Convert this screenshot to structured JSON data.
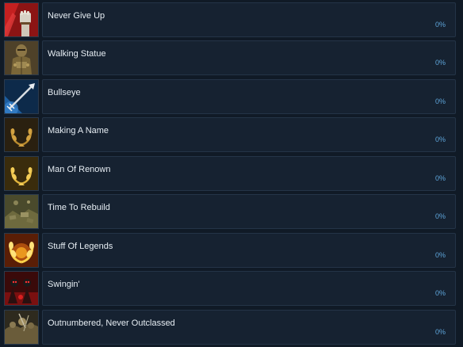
{
  "achievements": [
    {
      "title": "Never Give Up",
      "percent": "0%",
      "icon": "raised-fist-icon"
    },
    {
      "title": "Walking Statue",
      "percent": "0%",
      "icon": "armored-knight-icon"
    },
    {
      "title": "Bullseye",
      "percent": "0%",
      "icon": "arrow-icon"
    },
    {
      "title": "Making A Name",
      "percent": "0%",
      "icon": "bronze-laurel-icon"
    },
    {
      "title": "Man Of Renown",
      "percent": "0%",
      "icon": "silver-laurel-icon"
    },
    {
      "title": "Time To Rebuild",
      "percent": "0%",
      "icon": "rubble-icon"
    },
    {
      "title": "Stuff Of Legends",
      "percent": "0%",
      "icon": "gold-laurel-icon"
    },
    {
      "title": "Swingin'",
      "percent": "0%",
      "icon": "swinging-warriors-icon"
    },
    {
      "title": "Outnumbered, Never Outclassed",
      "percent": "0%",
      "icon": "battle-crowd-icon"
    }
  ],
  "colors": {
    "background": "#101a26",
    "card": "#162231",
    "title": "#e6edf3",
    "percent": "#5ea5da"
  }
}
